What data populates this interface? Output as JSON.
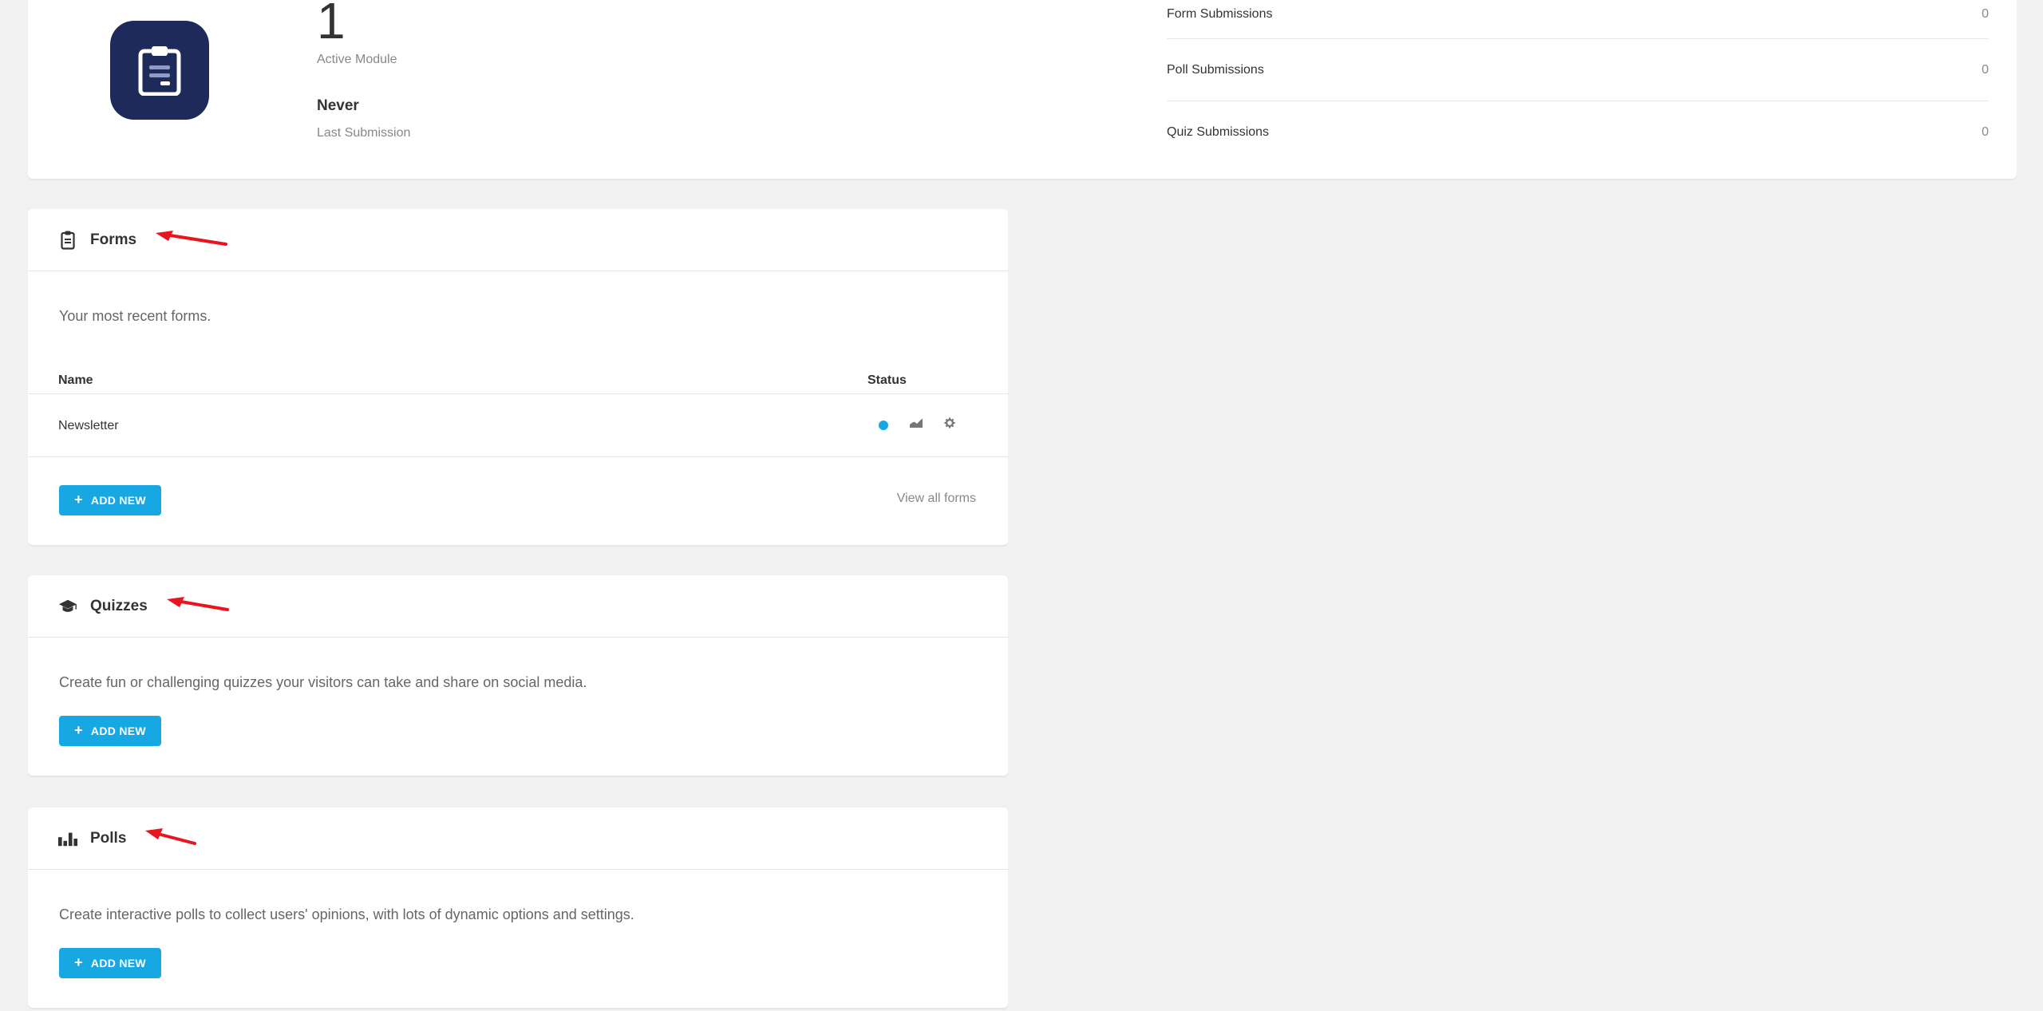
{
  "summary": {
    "active_count": "1",
    "active_label": "Active Module",
    "last_submission_value": "Never",
    "last_submission_label": "Last Submission",
    "submissions": [
      {
        "label": "Form Submissions",
        "value": "0"
      },
      {
        "label": "Poll Submissions",
        "value": "0"
      },
      {
        "label": "Quiz Submissions",
        "value": "0"
      }
    ]
  },
  "forms": {
    "title": "Forms",
    "description": "Your most recent forms.",
    "col_name": "Name",
    "col_status": "Status",
    "rows": [
      {
        "name": "Newsletter"
      }
    ],
    "add_label": "ADD NEW",
    "view_all": "View all forms"
  },
  "quizzes": {
    "title": "Quizzes",
    "description": "Create fun or challenging quizzes your visitors can take and share on social media.",
    "add_label": "ADD NEW"
  },
  "polls": {
    "title": "Polls",
    "description": "Create interactive polls to collect users' opinions, with lots of dynamic options and settings.",
    "add_label": "ADD NEW"
  },
  "colors": {
    "accent": "#17a8e3",
    "icon_bg": "#1e2a5a",
    "arrow": "#e8141e"
  },
  "icons": [
    "clipboard-icon",
    "graduation-cap-icon",
    "bar-chart-icon",
    "status-dot-icon",
    "stats-icon",
    "gear-icon",
    "plus-icon",
    "red-arrow-icon"
  ]
}
